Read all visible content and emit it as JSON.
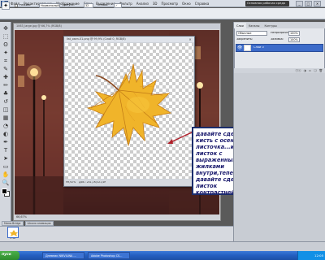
{
  "app": {
    "logo": "Ps",
    "menu": [
      "Файл",
      "Редактирование",
      "Изображение",
      "Слои",
      "Выделение",
      "Фильтр",
      "Анализ",
      "3D",
      "Просмотр",
      "Окно",
      "Справка"
    ],
    "workspace": "Основная рабочая среда",
    "window_controls": [
      "_",
      "□",
      "✕"
    ]
  },
  "options_bar": {
    "tool_icon": "magic-wand",
    "style_label": "Режим:",
    "style_value": "Нормальный",
    "region_label": "Допуск:",
    "region_value": "32",
    "tolerance_label": "Сглаж.",
    "tolerance_value": "✓"
  },
  "toolbar": {
    "tools": [
      "move-icon",
      "marquee-icon",
      "lasso-icon",
      "magic-wand-icon",
      "crop-icon",
      "eyedropper-icon",
      "healing-icon",
      "brush-icon",
      "clone-icon",
      "history-brush-icon",
      "eraser-icon",
      "gradient-icon",
      "blur-icon",
      "dodge-icon",
      "pen-icon",
      "type-icon",
      "path-select-icon",
      "shape-icon",
      "hand-icon",
      "zoom-icon"
    ],
    "glyphs": [
      "✥",
      "⬚",
      "ʘ",
      "✦",
      "⌗",
      "✎",
      "✚",
      "✏",
      "♣",
      "↺",
      "◫",
      "▦",
      "◔",
      "◐",
      "✒",
      "T",
      "➤",
      "▭",
      "✋",
      "🔍"
    ]
  },
  "bg_document": {
    "title": "1063_large.jpg @ 66,7% (RGB/8)",
    "status": "66,67%"
  },
  "leaf_document": {
    "title": "list_osen-01.png @ 99,9% (Слой 0, RGB/8)",
    "status_zoom": "99,92%",
    "status_info": "Док.: 241,1К/321,4К"
  },
  "annotation": {
    "text": "давайте сделаем\nкисть с осеннего\nлисточка...ищем\nлисток с\nвыраженными\nжилками\nвнутри,теперь\nдавайте сделаем\nлисток\nконтрастней"
  },
  "layers_panel": {
    "tabs": [
      "Слои",
      "Каналы",
      "Контуры"
    ],
    "blend_mode": "Обычные",
    "opacity_label": "Непрозрачность:",
    "opacity_value": "100%",
    "lock_label": "Закрепить:",
    "fill_label": "Заливка:",
    "fill_value": "100%",
    "layer_name": "Слой 0",
    "footer_icons": [
      "ⓕⓧ",
      "◑",
      "▭",
      "❏",
      "🗑"
    ]
  },
  "filmstrip": {
    "tabs": [
      "Мини-Bridge",
      "Шкала анимации"
    ],
    "thumb_label": "0 сек."
  },
  "taskbar": {
    "start": "пуск",
    "tasks": [
      "Дневник NIKVILINA ...",
      "Adobe Photoshop CS..."
    ],
    "clock": "12:05"
  }
}
